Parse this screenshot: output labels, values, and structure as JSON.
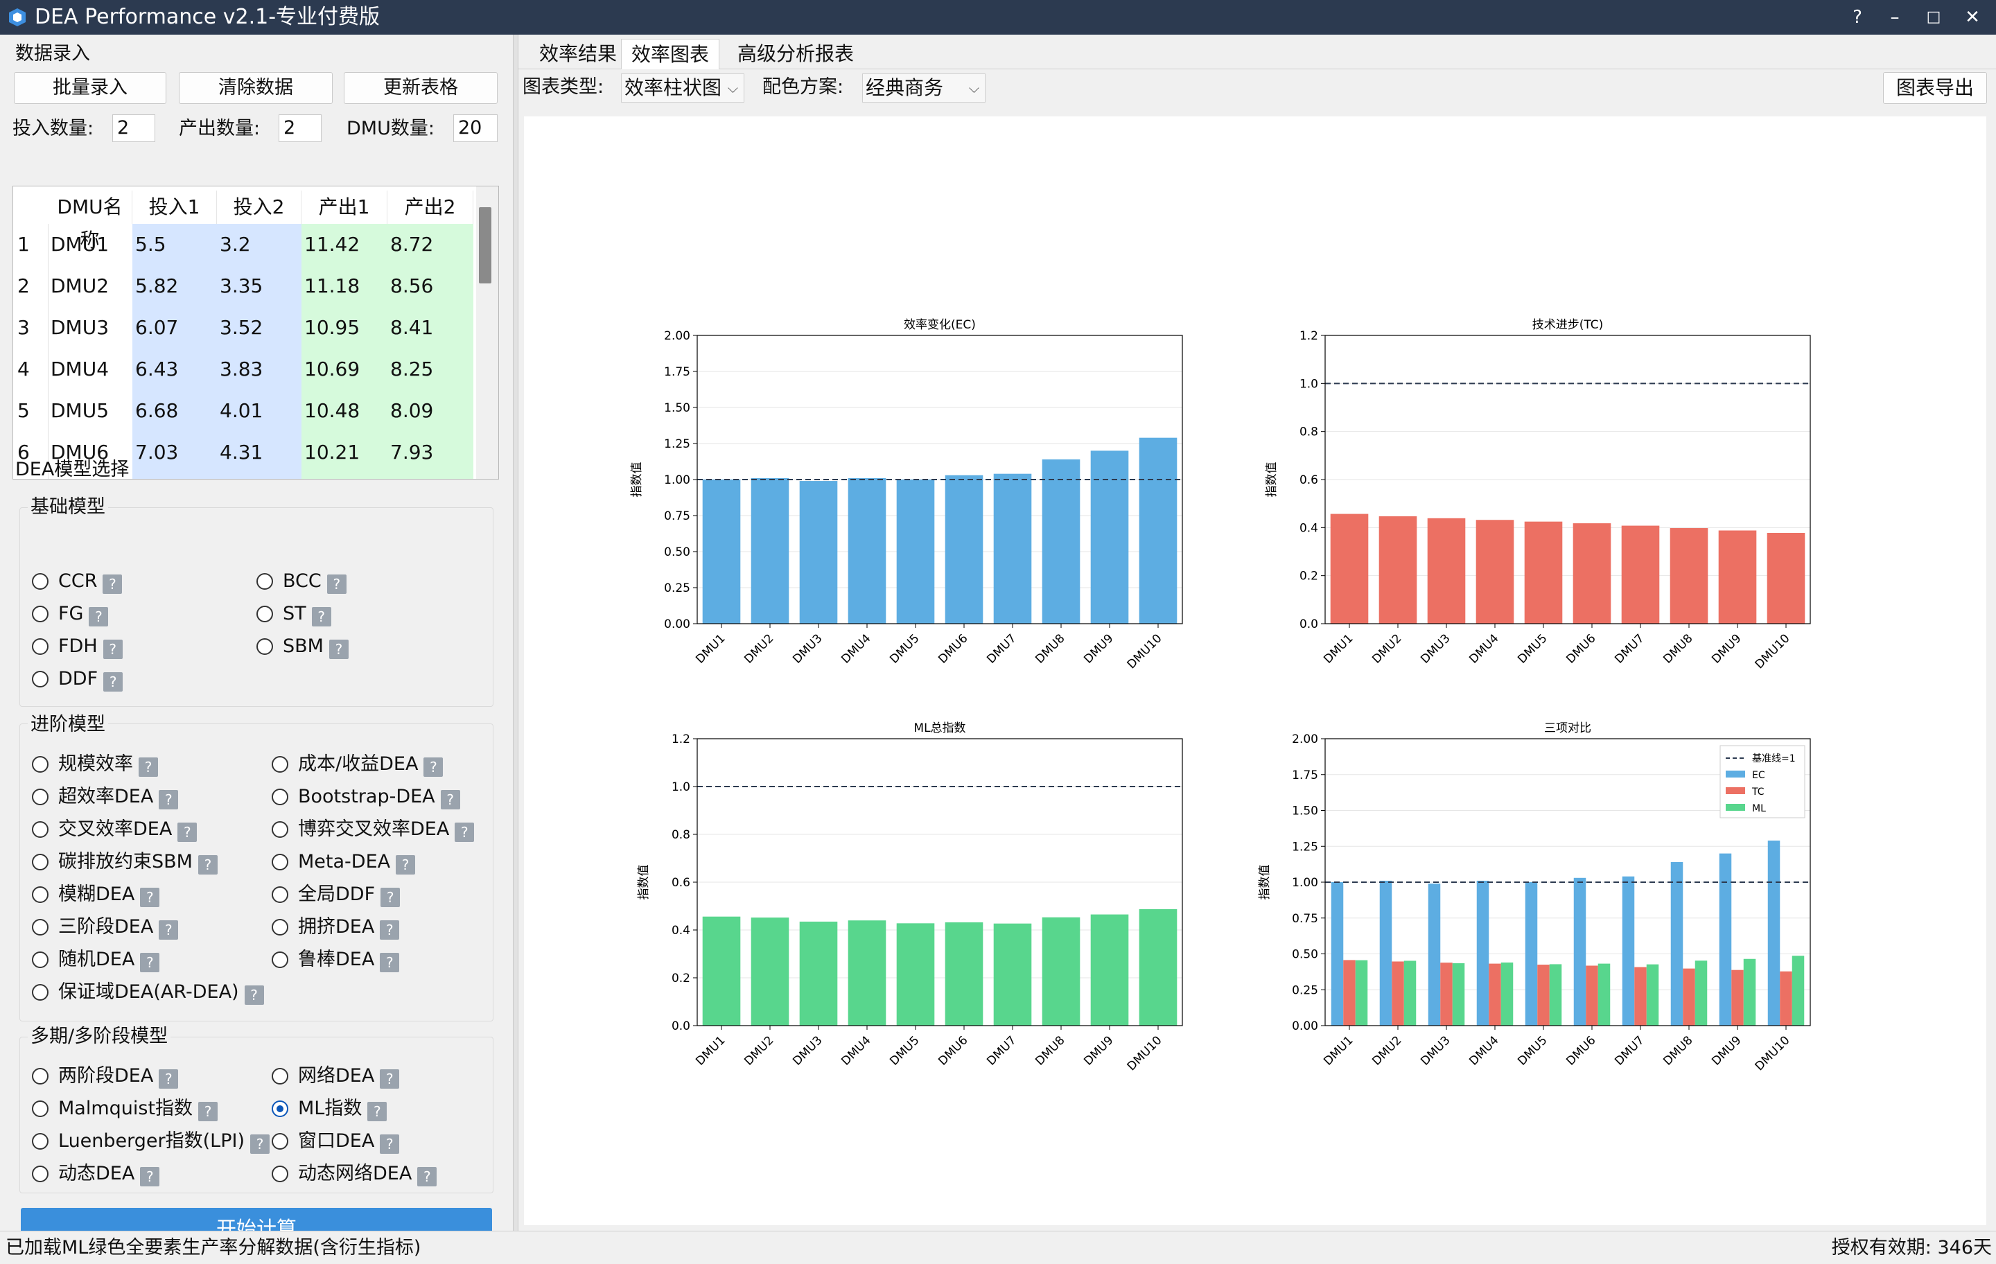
{
  "window": {
    "title": "DEA Performance v2.1-专业付费版",
    "help": "?",
    "minimize": "–",
    "maximize": "□",
    "close": "✕"
  },
  "data_entry": {
    "section_title": "数据录入",
    "batch_input": "批量录入",
    "clear_data": "清除数据",
    "update_table": "更新表格",
    "input_count_label": "投入数量:",
    "input_count": "2",
    "output_count_label": "产出数量:",
    "output_count": "2",
    "dmu_count_label": "DMU数量:",
    "dmu_count": "20",
    "columns": [
      "DMU名称",
      "投入1",
      "投入2",
      "产出1",
      "产出2"
    ],
    "rows": [
      {
        "num": "1",
        "name": "DMU1",
        "in1": "5.5",
        "in2": "3.2",
        "out1": "11.42",
        "out2": "8.72"
      },
      {
        "num": "2",
        "name": "DMU2",
        "in1": "5.82",
        "in2": "3.35",
        "out1": "11.18",
        "out2": "8.56"
      },
      {
        "num": "3",
        "name": "DMU3",
        "in1": "6.07",
        "in2": "3.52",
        "out1": "10.95",
        "out2": "8.41"
      },
      {
        "num": "4",
        "name": "DMU4",
        "in1": "6.43",
        "in2": "3.83",
        "out1": "10.69",
        "out2": "8.25"
      },
      {
        "num": "5",
        "name": "DMU5",
        "in1": "6.68",
        "in2": "4.01",
        "out1": "10.48",
        "out2": "8.09"
      },
      {
        "num": "6",
        "name": "DMU6",
        "in1": "7.03",
        "in2": "4.31",
        "out1": "10.21",
        "out2": "7.93"
      }
    ]
  },
  "model_select": {
    "section_title": "DEA模型选择",
    "help_glyph": "?",
    "basic": {
      "title": "基础模型",
      "items": [
        "CCR",
        "BCC",
        "FG",
        "ST",
        "FDH",
        "SBM",
        "DDF"
      ]
    },
    "advanced": {
      "title": "进阶模型",
      "items": [
        "规模效率",
        "成本/收益DEA",
        "超效率DEA",
        "Bootstrap-DEA",
        "交叉效率DEA",
        "博弈交叉效率DEA",
        "碳排放约束SBM",
        "Meta-DEA",
        "模糊DEA",
        "全局DDF",
        "三阶段DEA",
        "拥挤DEA",
        "随机DEA",
        "鲁棒DEA",
        "保证域DEA(AR-DEA)"
      ]
    },
    "multi": {
      "title": "多期/多阶段模型",
      "items": [
        "两阶段DEA",
        "网络DEA",
        "Malmquist指数",
        "ML指数",
        "Luenberger指数(LPI)",
        "窗口DEA",
        "动态DEA",
        "动态网络DEA"
      ],
      "selected": "ML指数"
    },
    "start_button": "开始计算"
  },
  "main": {
    "tabs": [
      "效率结果",
      "效率图表",
      "高级分析报表"
    ],
    "active_tab": "效率图表",
    "chart_type_label": "图表类型:",
    "chart_type_value": "效率柱状图",
    "color_scheme_label": "配色方案:",
    "color_scheme_value": "经典商务",
    "export_button": "图表导出"
  },
  "colors": {
    "titlebar": "#2c3a50",
    "ec": "#5dade2",
    "tc": "#ec7063",
    "ml": "#58d68d",
    "input_cells": "#d6e6ff",
    "output_cells": "#d6fadc",
    "accent": "#3a8fdc"
  },
  "chart_data": [
    {
      "type": "bar",
      "title": "效率变化(EC)",
      "ylabel": "指数值",
      "categories": [
        "DMU1",
        "DMU2",
        "DMU3",
        "DMU4",
        "DMU5",
        "DMU6",
        "DMU7",
        "DMU8",
        "DMU9",
        "DMU10"
      ],
      "values": [
        1.0,
        1.01,
        0.99,
        1.01,
        1.0,
        1.03,
        1.04,
        1.14,
        1.2,
        1.29
      ],
      "ylim": [
        0,
        2.0
      ],
      "yticks": [
        "0.00",
        "0.25",
        "0.50",
        "0.75",
        "1.00",
        "1.25",
        "1.50",
        "1.75",
        "2.00"
      ],
      "reference_line": 1.0,
      "color": "#5dade2",
      "grid": true
    },
    {
      "type": "bar",
      "title": "技术进步(TC)",
      "ylabel": "指数值",
      "categories": [
        "DMU1",
        "DMU2",
        "DMU3",
        "DMU4",
        "DMU5",
        "DMU6",
        "DMU7",
        "DMU8",
        "DMU9",
        "DMU10"
      ],
      "values": [
        0.457,
        0.447,
        0.439,
        0.432,
        0.425,
        0.418,
        0.408,
        0.398,
        0.388,
        0.378
      ],
      "ylim": [
        0,
        1.2
      ],
      "yticks": [
        "0.0",
        "0.2",
        "0.4",
        "0.6",
        "0.8",
        "1.0",
        "1.2"
      ],
      "reference_line": 1.0,
      "color": "#ec7063",
      "grid": true
    },
    {
      "type": "bar",
      "title": "ML总指数",
      "ylabel": "指数值",
      "categories": [
        "DMU1",
        "DMU2",
        "DMU3",
        "DMU4",
        "DMU5",
        "DMU6",
        "DMU7",
        "DMU8",
        "DMU9",
        "DMU10"
      ],
      "values": [
        0.456,
        0.452,
        0.435,
        0.44,
        0.428,
        0.432,
        0.427,
        0.453,
        0.465,
        0.487
      ],
      "ylim": [
        0,
        1.2
      ],
      "yticks": [
        "0.0",
        "0.2",
        "0.4",
        "0.6",
        "0.8",
        "1.0",
        "1.2"
      ],
      "reference_line": 1.0,
      "color": "#58d68d",
      "grid": true
    },
    {
      "type": "bar",
      "title": "三项对比",
      "ylabel": "指数值",
      "categories": [
        "DMU1",
        "DMU2",
        "DMU3",
        "DMU4",
        "DMU5",
        "DMU6",
        "DMU7",
        "DMU8",
        "DMU9",
        "DMU10"
      ],
      "ylim": [
        0,
        2.0
      ],
      "yticks": [
        "0.00",
        "0.25",
        "0.50",
        "0.75",
        "1.00",
        "1.25",
        "1.50",
        "1.75",
        "2.00"
      ],
      "reference_line": 1.0,
      "grid": true,
      "legend": "top-right",
      "legend_baseline": "基准线=1",
      "series": [
        {
          "name": "EC",
          "color": "#5dade2",
          "values": [
            1.0,
            1.01,
            0.99,
            1.01,
            1.0,
            1.03,
            1.04,
            1.14,
            1.2,
            1.29
          ]
        },
        {
          "name": "TC",
          "color": "#ec7063",
          "values": [
            0.457,
            0.447,
            0.439,
            0.432,
            0.425,
            0.418,
            0.408,
            0.398,
            0.388,
            0.378
          ]
        },
        {
          "name": "ML",
          "color": "#58d68d",
          "values": [
            0.456,
            0.452,
            0.435,
            0.44,
            0.428,
            0.432,
            0.427,
            0.453,
            0.465,
            0.487
          ]
        }
      ]
    }
  ],
  "status": {
    "left": "已加载ML绿色全要素生产率分解数据(含衍生指标)",
    "right": "授权有效期: 346天"
  }
}
